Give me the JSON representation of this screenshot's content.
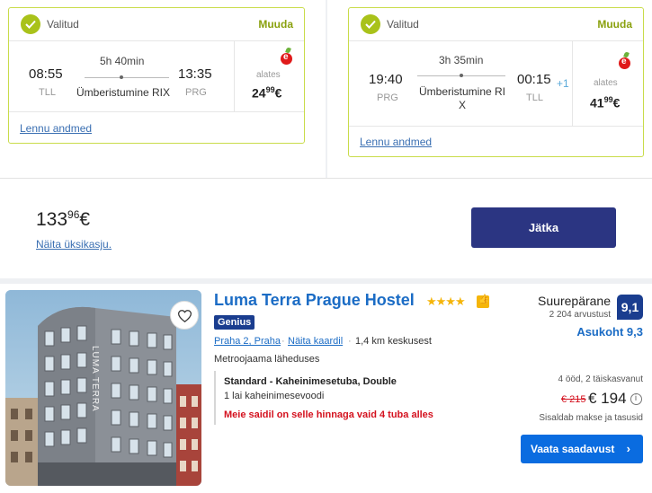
{
  "colors": {
    "accent_green": "#a9c21a",
    "primary_blue": "#2b3582",
    "link_blue": "#1b6cc5",
    "alert_red": "#d4111e"
  },
  "outbound": {
    "selected_label": "Valitud",
    "change_label": "Muuda",
    "depart_time": "08:55",
    "depart_airport": "TLL",
    "arrive_time": "13:35",
    "arrive_airport": "PRG",
    "duration": "5h 40min",
    "via": "Ümberistumine RIX",
    "from_label": "alates",
    "price_main": "24",
    "price_cents": "99",
    "price_currency": "€",
    "details_link": "Lennu andmed"
  },
  "inbound": {
    "selected_label": "Valitud",
    "change_label": "Muuda",
    "depart_time": "19:40",
    "depart_airport": "PRG",
    "arrive_time": "00:15",
    "arrive_airport": "TLL",
    "day_offset": "+1",
    "duration": "3h 35min",
    "via_line1": "Ümberistumine RI",
    "via_line2": "X",
    "from_label": "alates",
    "price_main": "41",
    "price_cents": "99",
    "price_currency": "€",
    "details_link": "Lennu andmed"
  },
  "total": {
    "price_main": "133",
    "price_cents": "96",
    "price_currency": "€",
    "single_price_link": "Näita üksikasju.",
    "continue_label": "Jätka"
  },
  "hotel": {
    "name": "Luma Terra Prague Hostel",
    "stars": "★★★★",
    "thumb_badge": "👍",
    "genius_label": "Genius",
    "area_link": "Praha 2, Praha",
    "map_link": "Näita kaardil",
    "distance": "1,4 km keskusest",
    "near_metro": "Metroojaama läheduses",
    "room_type": "Standard - Kaheinimesetuba, Double",
    "bed_info": "1 lai kaheinimesevoodi",
    "scarcity_msg": "Meie saidil on selle hinnaga vaid 4 tuba alles",
    "review_word": "Suurepärane",
    "review_count": "2 204 arvustust",
    "review_score": "9,1",
    "location_score": "Asukoht 9,3",
    "stay_info": "4 ööd, 2 täiskasvanut",
    "old_price": "€ 215",
    "new_price": "€ 194",
    "taxes_note": "Sisaldab makse ja tasusid",
    "availability_button": "Vaata saadavust",
    "building_sign": "LUMA TERRA"
  }
}
